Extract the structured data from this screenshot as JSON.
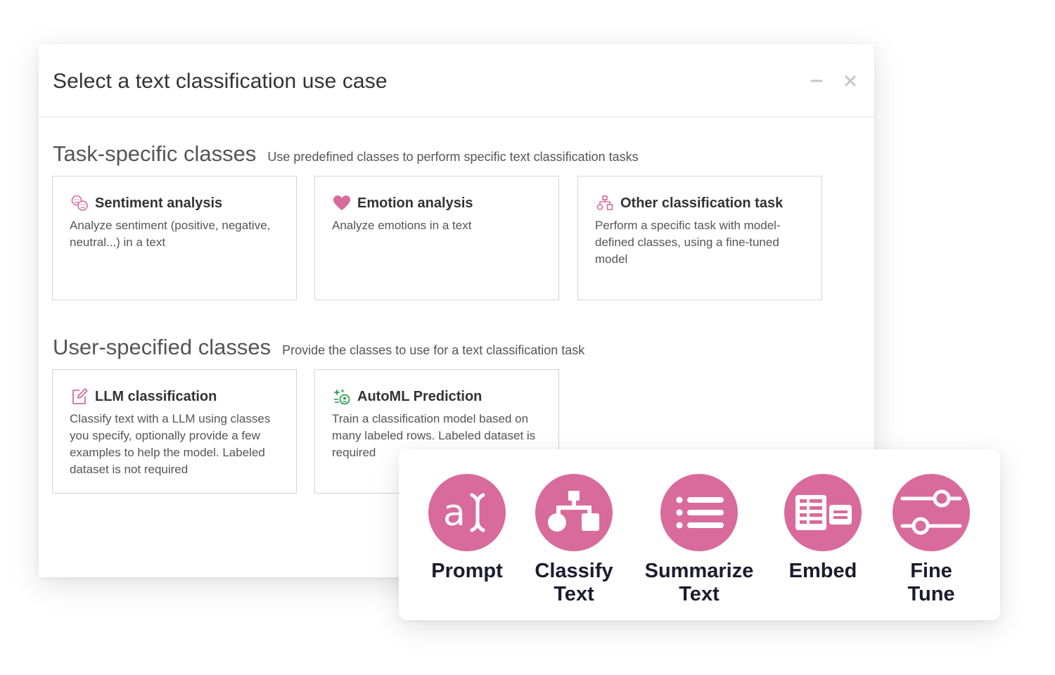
{
  "dialog": {
    "title": "Select a text classification use case"
  },
  "task_specific": {
    "title": "Task-specific classes",
    "description": "Use predefined classes to perform specific text classification tasks",
    "cards": [
      {
        "icon": "sentiment-faces-icon",
        "title": "Sentiment analysis",
        "description": "Analyze sentiment (positive, negative, neutral...) in a text"
      },
      {
        "icon": "heart-icon",
        "title": "Emotion analysis",
        "description": "Analyze emotions in a text"
      },
      {
        "icon": "classification-tree-icon",
        "title": "Other classification task",
        "description": "Perform a specific task with model-defined classes, using a fine-tuned model"
      }
    ]
  },
  "user_specified": {
    "title": "User-specified classes",
    "description": "Provide the classes to use for a text classification task",
    "cards": [
      {
        "icon": "edit-note-icon",
        "title": "LLM classification",
        "description": "Classify text with a LLM using classes you specify, optionally provide a few examples to help the model. Labeled dataset is not required"
      },
      {
        "icon": "automl-sparkle-icon",
        "title": "AutoML Prediction",
        "description": "Train a classification model based on many labeled rows. Labeled dataset is required"
      }
    ]
  },
  "tools": [
    {
      "icon": "text-cursor-icon",
      "label": "Prompt"
    },
    {
      "icon": "hierarchy-icon",
      "label": "Classify\nText"
    },
    {
      "icon": "list-icon",
      "label": "Summarize\nText"
    },
    {
      "icon": "embed-table-icon",
      "label": "Embed"
    },
    {
      "icon": "sliders-icon",
      "label": "Fine\nTune"
    }
  ],
  "colors": {
    "accent_pink": "#d86b9b",
    "heading_dark": "#1c1b2e",
    "automl_green": "#2e9e4f",
    "window_button_gray": "#c6c6c6"
  }
}
